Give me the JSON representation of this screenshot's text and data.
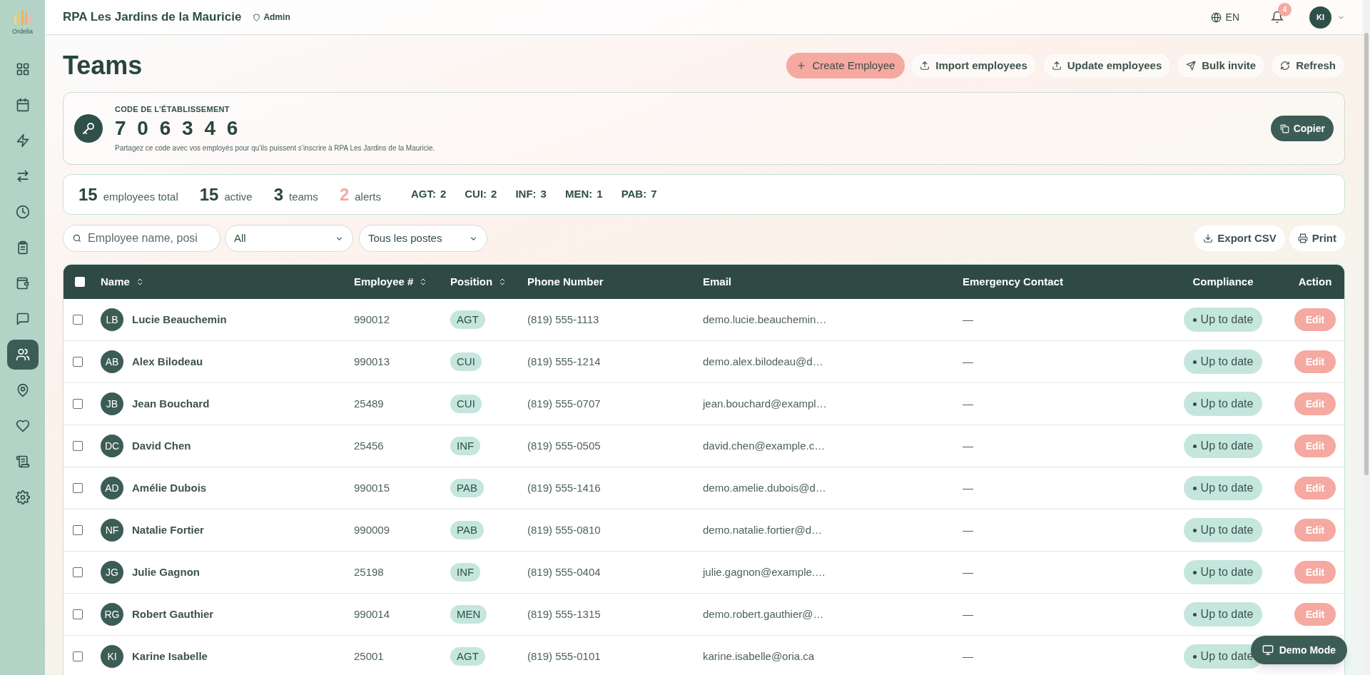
{
  "sidebar": {
    "logo_text": "Ordelia",
    "items": [
      {
        "selected": false
      },
      {
        "selected": false
      },
      {
        "selected": false
      },
      {
        "selected": false
      },
      {
        "selected": false
      },
      {
        "selected": false
      },
      {
        "selected": false
      },
      {
        "selected": false
      },
      {
        "selected": true
      },
      {
        "selected": false
      },
      {
        "selected": false
      },
      {
        "selected": false
      },
      {
        "selected": false
      }
    ]
  },
  "header": {
    "title": "RPA Les Jardins de la Mauricie",
    "role": "Admin",
    "language": "EN",
    "notifications": "4",
    "avatar": "KI"
  },
  "page_title": "Teams",
  "actions": [
    {
      "label": "Create Employee",
      "kind": "primary"
    },
    {
      "label": "Import employees",
      "kind": "upload"
    },
    {
      "label": "Update employees",
      "kind": "upload"
    },
    {
      "label": "Bulk invite",
      "kind": "send"
    },
    {
      "label": "Refresh",
      "kind": "refresh"
    }
  ],
  "code_card": {
    "label": "CODE DE L’ÉTABLISSEMENT",
    "code": "7 0 6 3 4 6",
    "hint": "Partagez ce code avec vos employés pour qu’ils puissent s’inscrire à RPA Les Jardins de la Mauricie.",
    "button": "Copier"
  },
  "stats": [
    {
      "value": "15",
      "label": "employees total",
      "alert": false
    },
    {
      "value": "15",
      "label": "active",
      "alert": false
    },
    {
      "value": "3",
      "label": "teams",
      "alert": false
    },
    {
      "value": "2",
      "label": "alerts",
      "alert": true
    }
  ],
  "position_counts": [
    {
      "label": "AGT:",
      "value": "2"
    },
    {
      "label": "CUI:",
      "value": "2"
    },
    {
      "label": "INF:",
      "value": "3"
    },
    {
      "label": "MEN:",
      "value": "1"
    },
    {
      "label": "PAB:",
      "value": "7"
    }
  ],
  "filters": {
    "search_placeholder": "Employee name, posi",
    "status": "All",
    "position": "Tous les postes"
  },
  "tools": [
    {
      "label": "Export CSV",
      "kind": "download"
    },
    {
      "label": "Print",
      "kind": "print"
    }
  ],
  "table": {
    "select_all_checked": false,
    "columns": [
      {
        "label": "Name",
        "sortable": true
      },
      {
        "label": "Employee #",
        "sortable": true
      },
      {
        "label": "Position",
        "sortable": true
      },
      {
        "label": "Phone Number",
        "sortable": false
      },
      {
        "label": "Email",
        "sortable": false
      },
      {
        "label": "Emergency Contact",
        "sortable": false
      },
      {
        "label": "Compliance",
        "sortable": false
      },
      {
        "label": "Action",
        "sortable": false
      }
    ],
    "rows": [
      {
        "checked": false,
        "initials": "LB",
        "name": "Lucie Beauchemin",
        "number": "990012",
        "position": "AGT",
        "phone": "(819) 555-1113",
        "email": "demo.lucie.beauchemin…",
        "emergency": "—",
        "compliance": "Up to date",
        "action": "Edit"
      },
      {
        "checked": false,
        "initials": "AB",
        "name": "Alex Bilodeau",
        "number": "990013",
        "position": "CUI",
        "phone": "(819) 555-1214",
        "email": "demo.alex.bilodeau@d…",
        "emergency": "—",
        "compliance": "Up to date",
        "action": "Edit"
      },
      {
        "checked": false,
        "initials": "JB",
        "name": "Jean Bouchard",
        "number": "25489",
        "position": "CUI",
        "phone": "(819) 555-0707",
        "email": "jean.bouchard@exampl…",
        "emergency": "—",
        "compliance": "Up to date",
        "action": "Edit"
      },
      {
        "checked": false,
        "initials": "DC",
        "name": "David Chen",
        "number": "25456",
        "position": "INF",
        "phone": "(819) 555-0505",
        "email": "david.chen@example.c…",
        "emergency": "—",
        "compliance": "Up to date",
        "action": "Edit"
      },
      {
        "checked": false,
        "initials": "AD",
        "name": "Amélie Dubois",
        "number": "990015",
        "position": "PAB",
        "phone": "(819) 555-1416",
        "email": "demo.amelie.dubois@d…",
        "emergency": "—",
        "compliance": "Up to date",
        "action": "Edit"
      },
      {
        "checked": false,
        "initials": "NF",
        "name": "Natalie Fortier",
        "number": "990009",
        "position": "PAB",
        "phone": "(819) 555-0810",
        "email": "demo.natalie.fortier@d…",
        "emergency": "—",
        "compliance": "Up to date",
        "action": "Edit"
      },
      {
        "checked": false,
        "initials": "JG",
        "name": "Julie Gagnon",
        "number": "25198",
        "position": "INF",
        "phone": "(819) 555-0404",
        "email": "julie.gagnon@example.…",
        "emergency": "—",
        "compliance": "Up to date",
        "action": "Edit"
      },
      {
        "checked": false,
        "initials": "RG",
        "name": "Robert Gauthier",
        "number": "990014",
        "position": "MEN",
        "phone": "(819) 555-1315",
        "email": "demo.robert.gauthier@…",
        "emergency": "—",
        "compliance": "Up to date",
        "action": "Edit"
      },
      {
        "checked": false,
        "initials": "KI",
        "name": "Karine Isabelle",
        "number": "25001",
        "position": "AGT",
        "phone": "(819) 555-0101",
        "email": "karine.isabelle@oria.ca",
        "emergency": "—",
        "compliance": "Up to date"
      }
    ]
  },
  "demo_button": "Demo Mode"
}
